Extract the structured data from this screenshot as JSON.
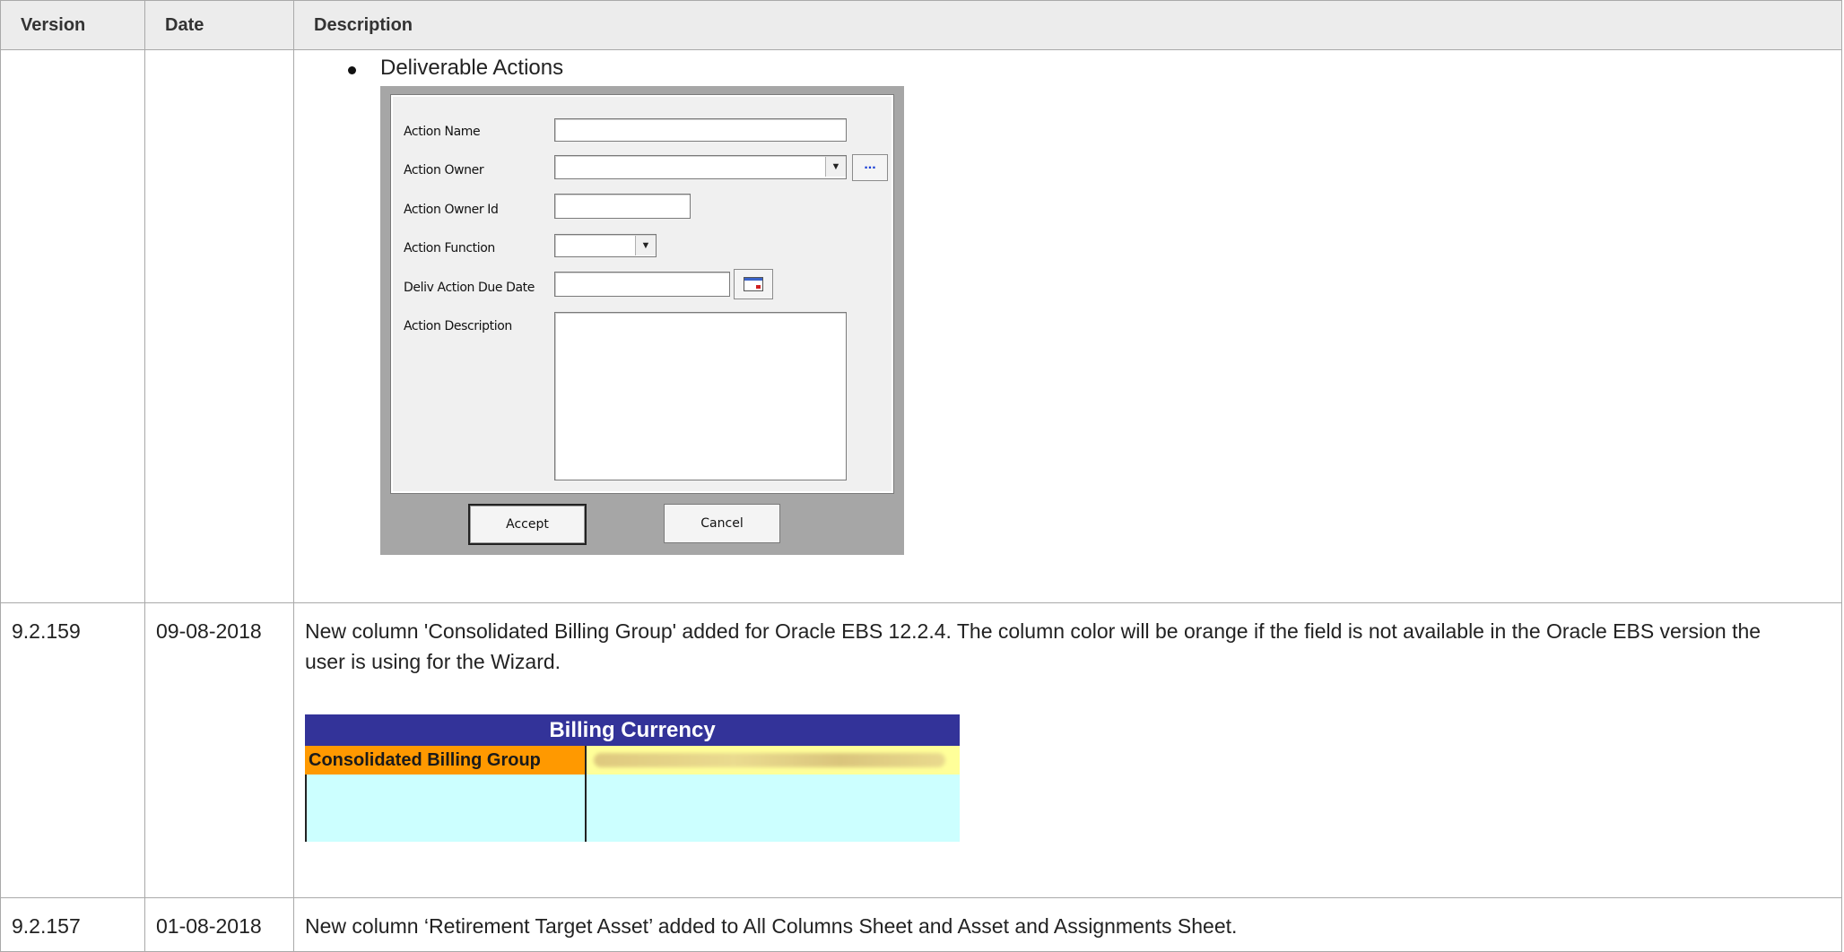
{
  "table": {
    "headers": {
      "version": "Version",
      "date": "Date",
      "description": "Description"
    }
  },
  "row1": {
    "bullet": "Deliverable Actions",
    "dialog": {
      "action_name": "Action Name",
      "action_owner": "Action Owner",
      "ellipsis": "...",
      "action_owner_id": "Action Owner Id",
      "action_function": "Action Function",
      "deliv_action_due_date": "Deliv Action Due Date",
      "action_description": "Action Description",
      "accept": "Accept",
      "cancel": "Cancel"
    }
  },
  "row2": {
    "version": "9.2.159",
    "date": "09-08-2018",
    "description": "New column 'Consolidated Billing Group' added for Oracle EBS 12.2.4.  The column color will be orange if the field is not available in the Oracle EBS version the user is using for the Wizard.",
    "sheet": {
      "header": "Billing Currency",
      "orange_col": "Consolidated Billing Group",
      "colors": {
        "header": "#333399",
        "orange": "#ff9900",
        "yellow": "#ffff99",
        "cyan": "#ccffff"
      }
    }
  },
  "row3": {
    "version": "9.2.157",
    "date": "01-08-2018",
    "description": "New column ‘Retirement Target Asset’ added to All Columns Sheet and Asset and Assignments Sheet."
  }
}
